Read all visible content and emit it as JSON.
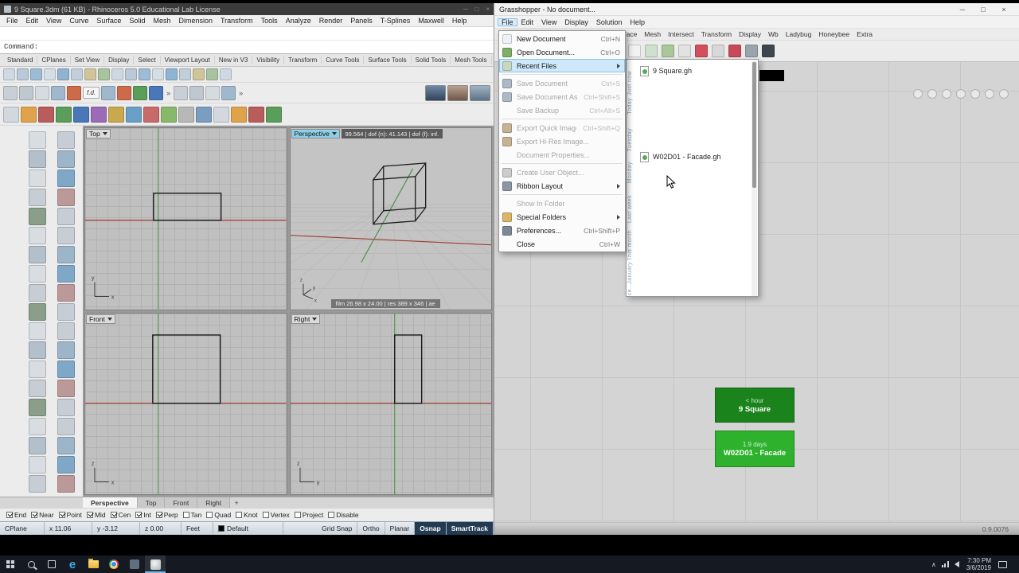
{
  "icons": {
    "minimize": "─",
    "maximize": "□",
    "close": "×",
    "overflow": "»",
    "tray_chevron": "∧",
    "add_viewport": "+",
    "edge_logo": "e"
  },
  "rhino": {
    "title": "9 Square.3dm (61 KB) - Rhinoceros 5.0 Educational Lab License",
    "menu_items": [
      "File",
      "Edit",
      "View",
      "Curve",
      "Surface",
      "Solid",
      "Mesh",
      "Dimension",
      "Transform",
      "Tools",
      "Analyze",
      "Render",
      "Panels",
      "T-Splines",
      "Maxwell",
      "Help"
    ],
    "command_prompt": "Command:",
    "toolbar_tabs": [
      "Standard",
      "CPlanes",
      "Set View",
      "Display",
      "Select",
      "Viewport Layout",
      "New in V3",
      "Visibility",
      "Transform",
      "Curve Tools",
      "Surface Tools",
      "Solid Tools",
      "Mesh Tools"
    ],
    "fd_label": "f.d.",
    "viewports": {
      "top": {
        "label": "Top"
      },
      "perspective": {
        "label": "Perspective",
        "hud": "99.564 | dof (n): 41.143 | dof (f): inf.",
        "film": "film 26.98 x 24.00 | res 389 x 346 | ae"
      },
      "front": {
        "label": "Front"
      },
      "right": {
        "label": "Right"
      }
    },
    "axis_labels": {
      "x": "x",
      "y": "y",
      "z": "z"
    },
    "viewport_tabs": [
      "Perspective",
      "Top",
      "Front",
      "Right"
    ],
    "osnap_items": [
      {
        "label": "End",
        "checked": true
      },
      {
        "label": "Near",
        "checked": true
      },
      {
        "label": "Point",
        "checked": true
      },
      {
        "label": "Mid",
        "checked": true
      },
      {
        "label": "Cen",
        "checked": true
      },
      {
        "label": "Int",
        "checked": true
      },
      {
        "label": "Perp",
        "checked": true
      },
      {
        "label": "Tan",
        "checked": false
      },
      {
        "label": "Quad",
        "checked": false
      },
      {
        "label": "Knot",
        "checked": false
      },
      {
        "label": "Vertex",
        "checked": false
      },
      {
        "label": "Project",
        "checked": false
      },
      {
        "label": "Disable",
        "checked": false
      }
    ],
    "status": {
      "cells": [
        "CPlane",
        "x 11.06",
        "y -3.12",
        "z 0.00",
        "Feet",
        "Default"
      ],
      "toggles": [
        {
          "label": "Grid Snap",
          "active": false
        },
        {
          "label": "Ortho",
          "active": false
        },
        {
          "label": "Planar",
          "active": false
        },
        {
          "label": "Osnap",
          "active": true
        },
        {
          "label": "SmartTrack",
          "active": true
        }
      ]
    },
    "decor": {
      "toolbar_row1_icons": 17,
      "toolbar_row2_icons": 15,
      "toolbar_row3_icons": 16,
      "sidebar_icons": 38,
      "render_thumbs": 3
    }
  },
  "grasshopper": {
    "title": "Grasshopper - No document...",
    "menu_items": [
      "File",
      "Edit",
      "View",
      "Display",
      "Solution",
      "Help"
    ],
    "ribbon_tabs": [
      "Surface",
      "Mesh",
      "Intersect",
      "Transform",
      "Display",
      "Wb",
      "Ladybug",
      "Honeybee",
      "Extra"
    ],
    "file_menu": [
      {
        "label": "New Document",
        "shortcut": "Ctrl+N",
        "icon": "new-document-icon",
        "icon_color": "#eef2f6"
      },
      {
        "label": "Open Document...",
        "shortcut": "Ctrl+O",
        "icon": "open-document-icon",
        "icon_color": "#7fae68"
      },
      {
        "label": "Recent Files",
        "highlighted": true,
        "submenu": true,
        "icon": "recent-files-icon",
        "icon_color": "#c8d8c0"
      },
      {
        "separator": true
      },
      {
        "label": "Save Document",
        "shortcut": "Ctrl+S",
        "disabled": true,
        "icon": "save-icon",
        "icon_color": "#aeb9c6"
      },
      {
        "label": "Save Document As...",
        "shortcut": "Ctrl+Shift+S",
        "disabled": true,
        "icon": "save-as-icon",
        "icon_color": "#aeb9c6"
      },
      {
        "label": "Save Backup",
        "shortcut": "Ctrl+Alt+S",
        "disabled": true
      },
      {
        "separator": true
      },
      {
        "label": "Export Quick Image...",
        "shortcut": "Ctrl+Shift+Q",
        "disabled": true,
        "icon": "export-image-icon",
        "icon_color": "#c7b393"
      },
      {
        "label": "Export Hi-Res Image...",
        "disabled": true,
        "icon": "export-hires-image-icon",
        "icon_color": "#c7b393"
      },
      {
        "label": "Document Properties...",
        "disabled": true
      },
      {
        "separator": true
      },
      {
        "label": "Create User Object...",
        "disabled": true,
        "icon": "user-object-icon",
        "icon_color": "#cccccc"
      },
      {
        "label": "Ribbon Layout",
        "submenu": true,
        "icon": "ribbon-layout-icon",
        "icon_color": "#8c97a3"
      },
      {
        "separator": true
      },
      {
        "label": "Show In Folder",
        "disabled": true
      },
      {
        "label": "Special Folders",
        "submenu": true,
        "icon": "special-fol ders-icon",
        "icon_color": "#d9b568"
      },
      {
        "label": "Preferences...",
        "shortcut": "Ctrl+Shift+P",
        "icon": "preferences-icon",
        "icon_color": "#7d8894"
      },
      {
        "label": "Close",
        "shortcut": "Ctrl+W"
      }
    ],
    "recent_panel": {
      "timeline_labels": [
        "Just now",
        "Today",
        "Tuesday",
        "Monday",
        "Last week",
        "This month",
        "January",
        "Dece..."
      ],
      "files": [
        {
          "name": "9 Square.gh"
        },
        {
          "name": "W02D01 - Facade.gh"
        }
      ]
    },
    "recent_tiles": [
      {
        "age": "< hour",
        "name": "9 Square",
        "color": "#1b831b"
      },
      {
        "age": "1.9 days",
        "name": "W02D01 - Facade",
        "color": "#2eb22e"
      }
    ],
    "version": "0.9.0076",
    "decor": {
      "toolbar_icons": 9,
      "canvas_widgets": 7
    }
  },
  "taskbar": {
    "icons": [
      "start",
      "search",
      "task-view",
      "edge",
      "file-explorer",
      "chrome",
      "app",
      "rhino"
    ],
    "time": "7:30 PM",
    "date": "3/6/2019"
  }
}
